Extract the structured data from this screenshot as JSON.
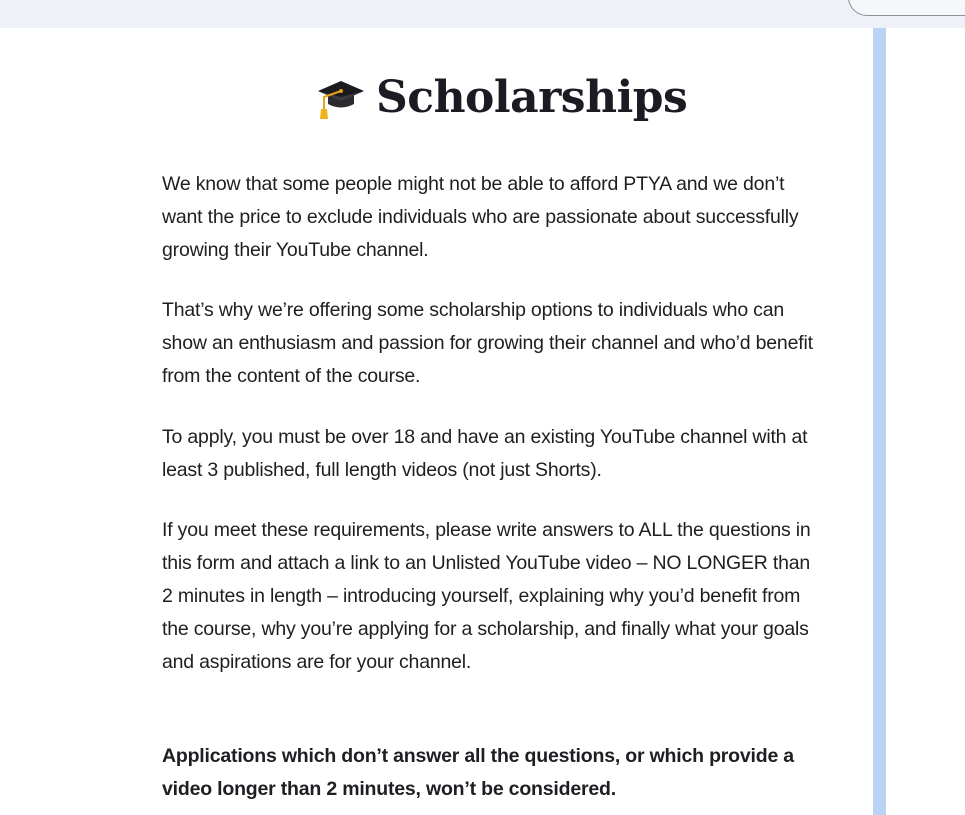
{
  "heading": {
    "icon": "graduation-cap-icon",
    "title": "Scholarships"
  },
  "paragraphs": [
    "We know that some people might not be able to afford PTYA and we don’t want the price to exclude individuals who are passionate about successfully growing their YouTube channel.",
    "That’s why we’re offering some scholarship options to individuals who can show an enthusiasm and passion for growing their channel and who’d benefit from the content of the course.",
    "To apply, you must be over 18 and have an existing YouTube channel with at least 3 published, full length videos (not just Shorts).",
    "If you meet these requirements, please write answers to ALL the questions in this form and attach a link to an Unlisted YouTube video – NO LONGER than 2 minutes in length – introducing yourself, explaining why you’d benefit from the course, why you’re applying for a scholarship, and finally what your goals and aspirations are for your channel.",
    "Applications which don’t answer all the questions, or which provide a video longer than 2 minutes, won’t be considered."
  ],
  "colors": {
    "top_bar": "#eef1f7",
    "scrollbar": "#b9d3f5",
    "text": "#1e1e23"
  }
}
